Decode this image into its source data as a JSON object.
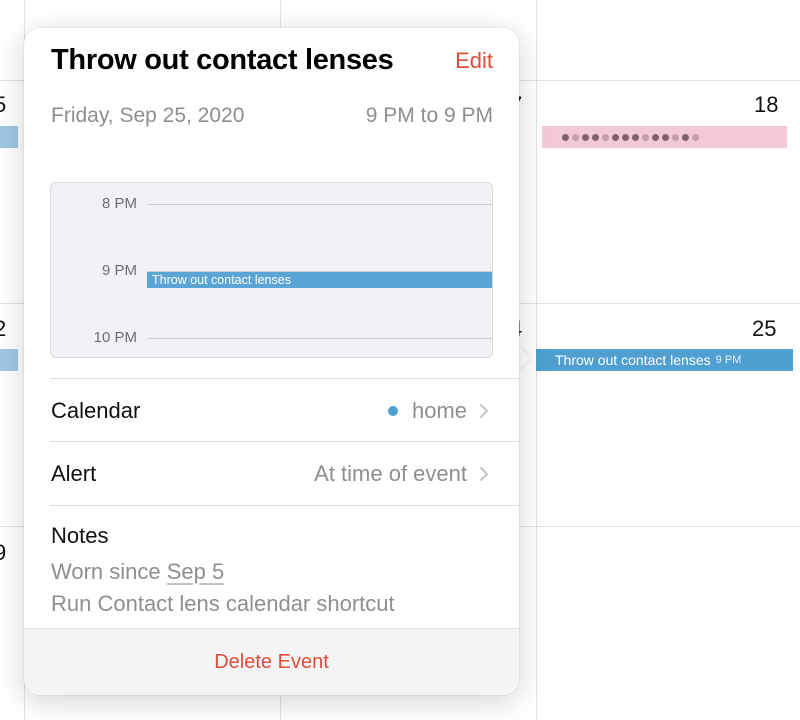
{
  "calendar_grid": {
    "day_numbers": [
      "5",
      "7",
      "18",
      "2",
      "4",
      "25",
      "9"
    ],
    "events": [
      {
        "title": "Throw out contact lenses",
        "time": "9 PM",
        "color": "#4f9fd1"
      }
    ]
  },
  "popover": {
    "title": "Throw out contact lenses",
    "edit_label": "Edit",
    "date": "Friday, Sep 25, 2020",
    "time_range": "9 PM to 9 PM",
    "timeline": {
      "hours": [
        "8 PM",
        "9 PM",
        "10 PM"
      ],
      "event_title": "Throw out contact lenses"
    },
    "calendar_row": {
      "label": "Calendar",
      "value": "home",
      "dot_color": "#4f9fd1"
    },
    "alert_row": {
      "label": "Alert",
      "value": "At time of event"
    },
    "notes": {
      "label": "Notes",
      "line1_prefix": "Worn since ",
      "line1_link": "Sep 5",
      "line2": "Run Contact lens calendar shortcut"
    },
    "delete_label": "Delete Event"
  },
  "colors": {
    "accent_red": "#de4d3b",
    "event_blue": "#4f9fd1",
    "secondary_text": "#8e8e93"
  }
}
